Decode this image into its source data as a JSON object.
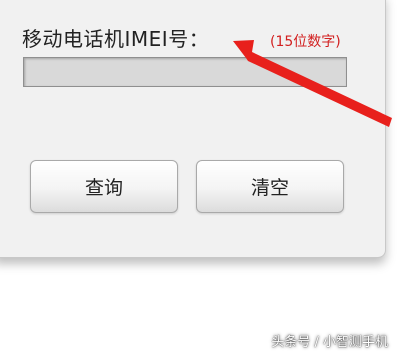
{
  "form": {
    "imei_label": "移动电话机IMEI号：",
    "imei_hint": "(15位数字)",
    "imei_value": "",
    "imei_placeholder": ""
  },
  "buttons": {
    "query_label": "查询",
    "clear_label": "清空"
  },
  "annotation": {
    "arrow_color": "#e8201c",
    "arrow_icon": "red-arrow-icon"
  },
  "watermark": {
    "text": "头条号 / 小智测手机"
  }
}
